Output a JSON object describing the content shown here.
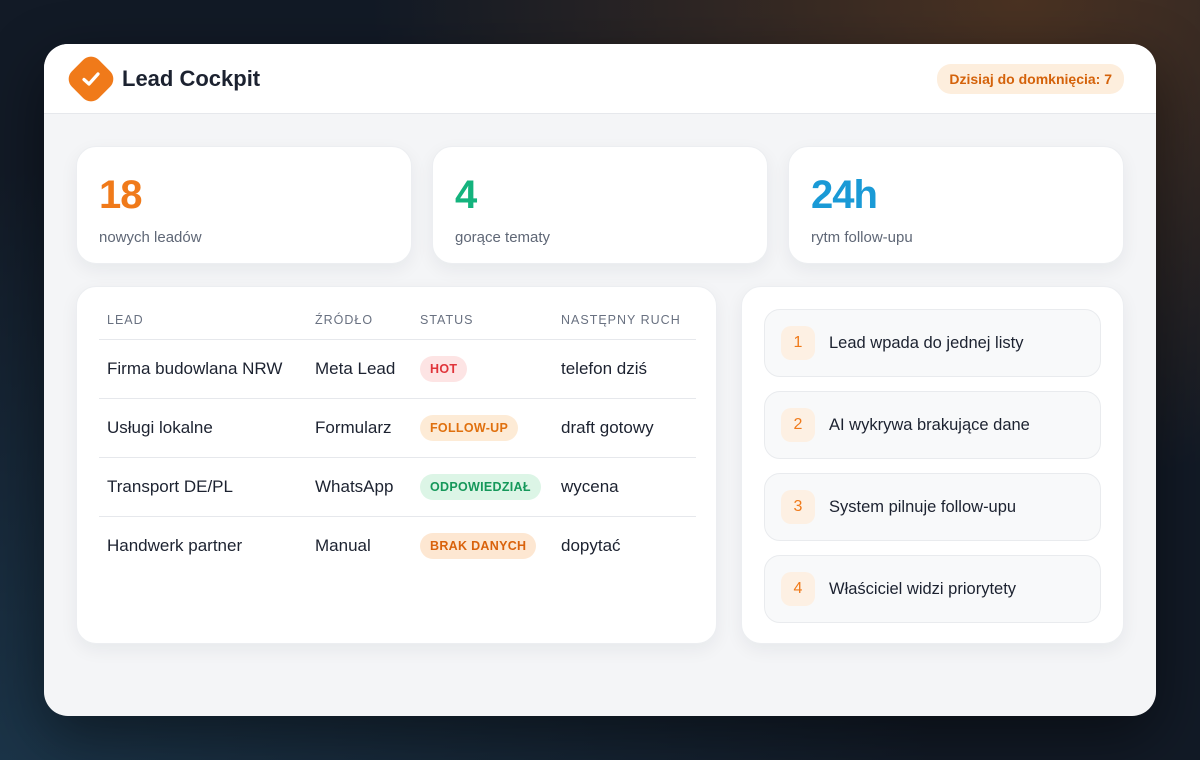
{
  "header": {
    "title": "Lead Cockpit",
    "badge": "Dzisiaj do domknięcia: 7",
    "logo_icon": "check-icon",
    "accent_color": "#f07a1a"
  },
  "stats": [
    {
      "value": "18",
      "label": "nowych leadów",
      "color": "#f07a1a"
    },
    {
      "value": "4",
      "label": "gorące tematy",
      "color": "#14b37d"
    },
    {
      "value": "24h",
      "label": "rytm follow-upu",
      "color": "#1a9ad6"
    }
  ],
  "table": {
    "columns": [
      "LEAD",
      "ŹRÓDŁO",
      "STATUS",
      "NASTĘPNY RUCH"
    ],
    "rows": [
      {
        "lead": "Firma budowlana NRW",
        "source": "Meta Lead",
        "status": "HOT",
        "next": "telefon dziś"
      },
      {
        "lead": "Usługi lokalne",
        "source": "Formularz",
        "status": "FOLLOW-UP",
        "next": "draft gotowy"
      },
      {
        "lead": "Transport DE/PL",
        "source": "WhatsApp",
        "status": "ODPOWIEDZIAŁ",
        "next": "wycena"
      },
      {
        "lead": "Handwerk partner",
        "source": "Manual",
        "status": "BRAK DANYCH",
        "next": "dopytać"
      }
    ],
    "status_colors": {
      "HOT": {
        "bg": "#fde4e4",
        "fg": "#e0343a"
      },
      "FOLLOW-UP": {
        "bg": "#fdebd6",
        "fg": "#e0700e"
      },
      "ODPOWIEDZIAŁ": {
        "bg": "#dcf5e6",
        "fg": "#15985a"
      },
      "BRAK DANYCH": {
        "bg": "#fde7d2",
        "fg": "#d9620c"
      }
    }
  },
  "steps": [
    {
      "num": "1",
      "text": "Lead wpada do jednej listy"
    },
    {
      "num": "2",
      "text": "AI wykrywa brakujące dane"
    },
    {
      "num": "3",
      "text": "System pilnuje follow-upu"
    },
    {
      "num": "4",
      "text": "Właściciel widzi priorytety"
    }
  ]
}
